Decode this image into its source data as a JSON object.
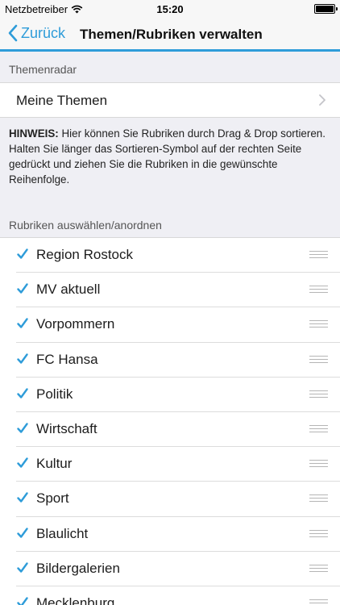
{
  "status_bar": {
    "carrier": "Netzbetreiber",
    "time": "15:20"
  },
  "nav": {
    "back_label": "Zurück",
    "title": "Themen/Rubriken verwalten"
  },
  "themenradar": {
    "header": "Themenradar",
    "item_label": "Meine Themen"
  },
  "hint": {
    "label": "HINWEIS:",
    "text": " Hier können Sie Rubriken durch Drag & Drop sortieren. Halten Sie länger das Sortieren-Symbol auf der rechten Seite gedrückt und ziehen Sie die Rubriken in die gewünschte Reihenfolge."
  },
  "rubriken": {
    "header": "Rubriken auswählen/anordnen",
    "items": [
      {
        "label": "Region Rostock",
        "checked": true
      },
      {
        "label": "MV aktuell",
        "checked": true
      },
      {
        "label": "Vorpommern",
        "checked": true
      },
      {
        "label": "FC Hansa",
        "checked": true
      },
      {
        "label": "Politik",
        "checked": true
      },
      {
        "label": "Wirtschaft",
        "checked": true
      },
      {
        "label": "Kultur",
        "checked": true
      },
      {
        "label": "Sport",
        "checked": true
      },
      {
        "label": "Blaulicht",
        "checked": true
      },
      {
        "label": "Bildergalerien",
        "checked": true
      },
      {
        "label": "Mecklenburg",
        "checked": true
      }
    ]
  },
  "colors": {
    "accent": "#2e9cd9",
    "background": "#efeff4"
  },
  "icons": {
    "back": "chevron-left-icon",
    "disclosure": "chevron-right-icon",
    "check": "checkmark-icon",
    "reorder": "reorder-handle-icon",
    "wifi": "wifi-icon",
    "battery": "battery-icon"
  }
}
